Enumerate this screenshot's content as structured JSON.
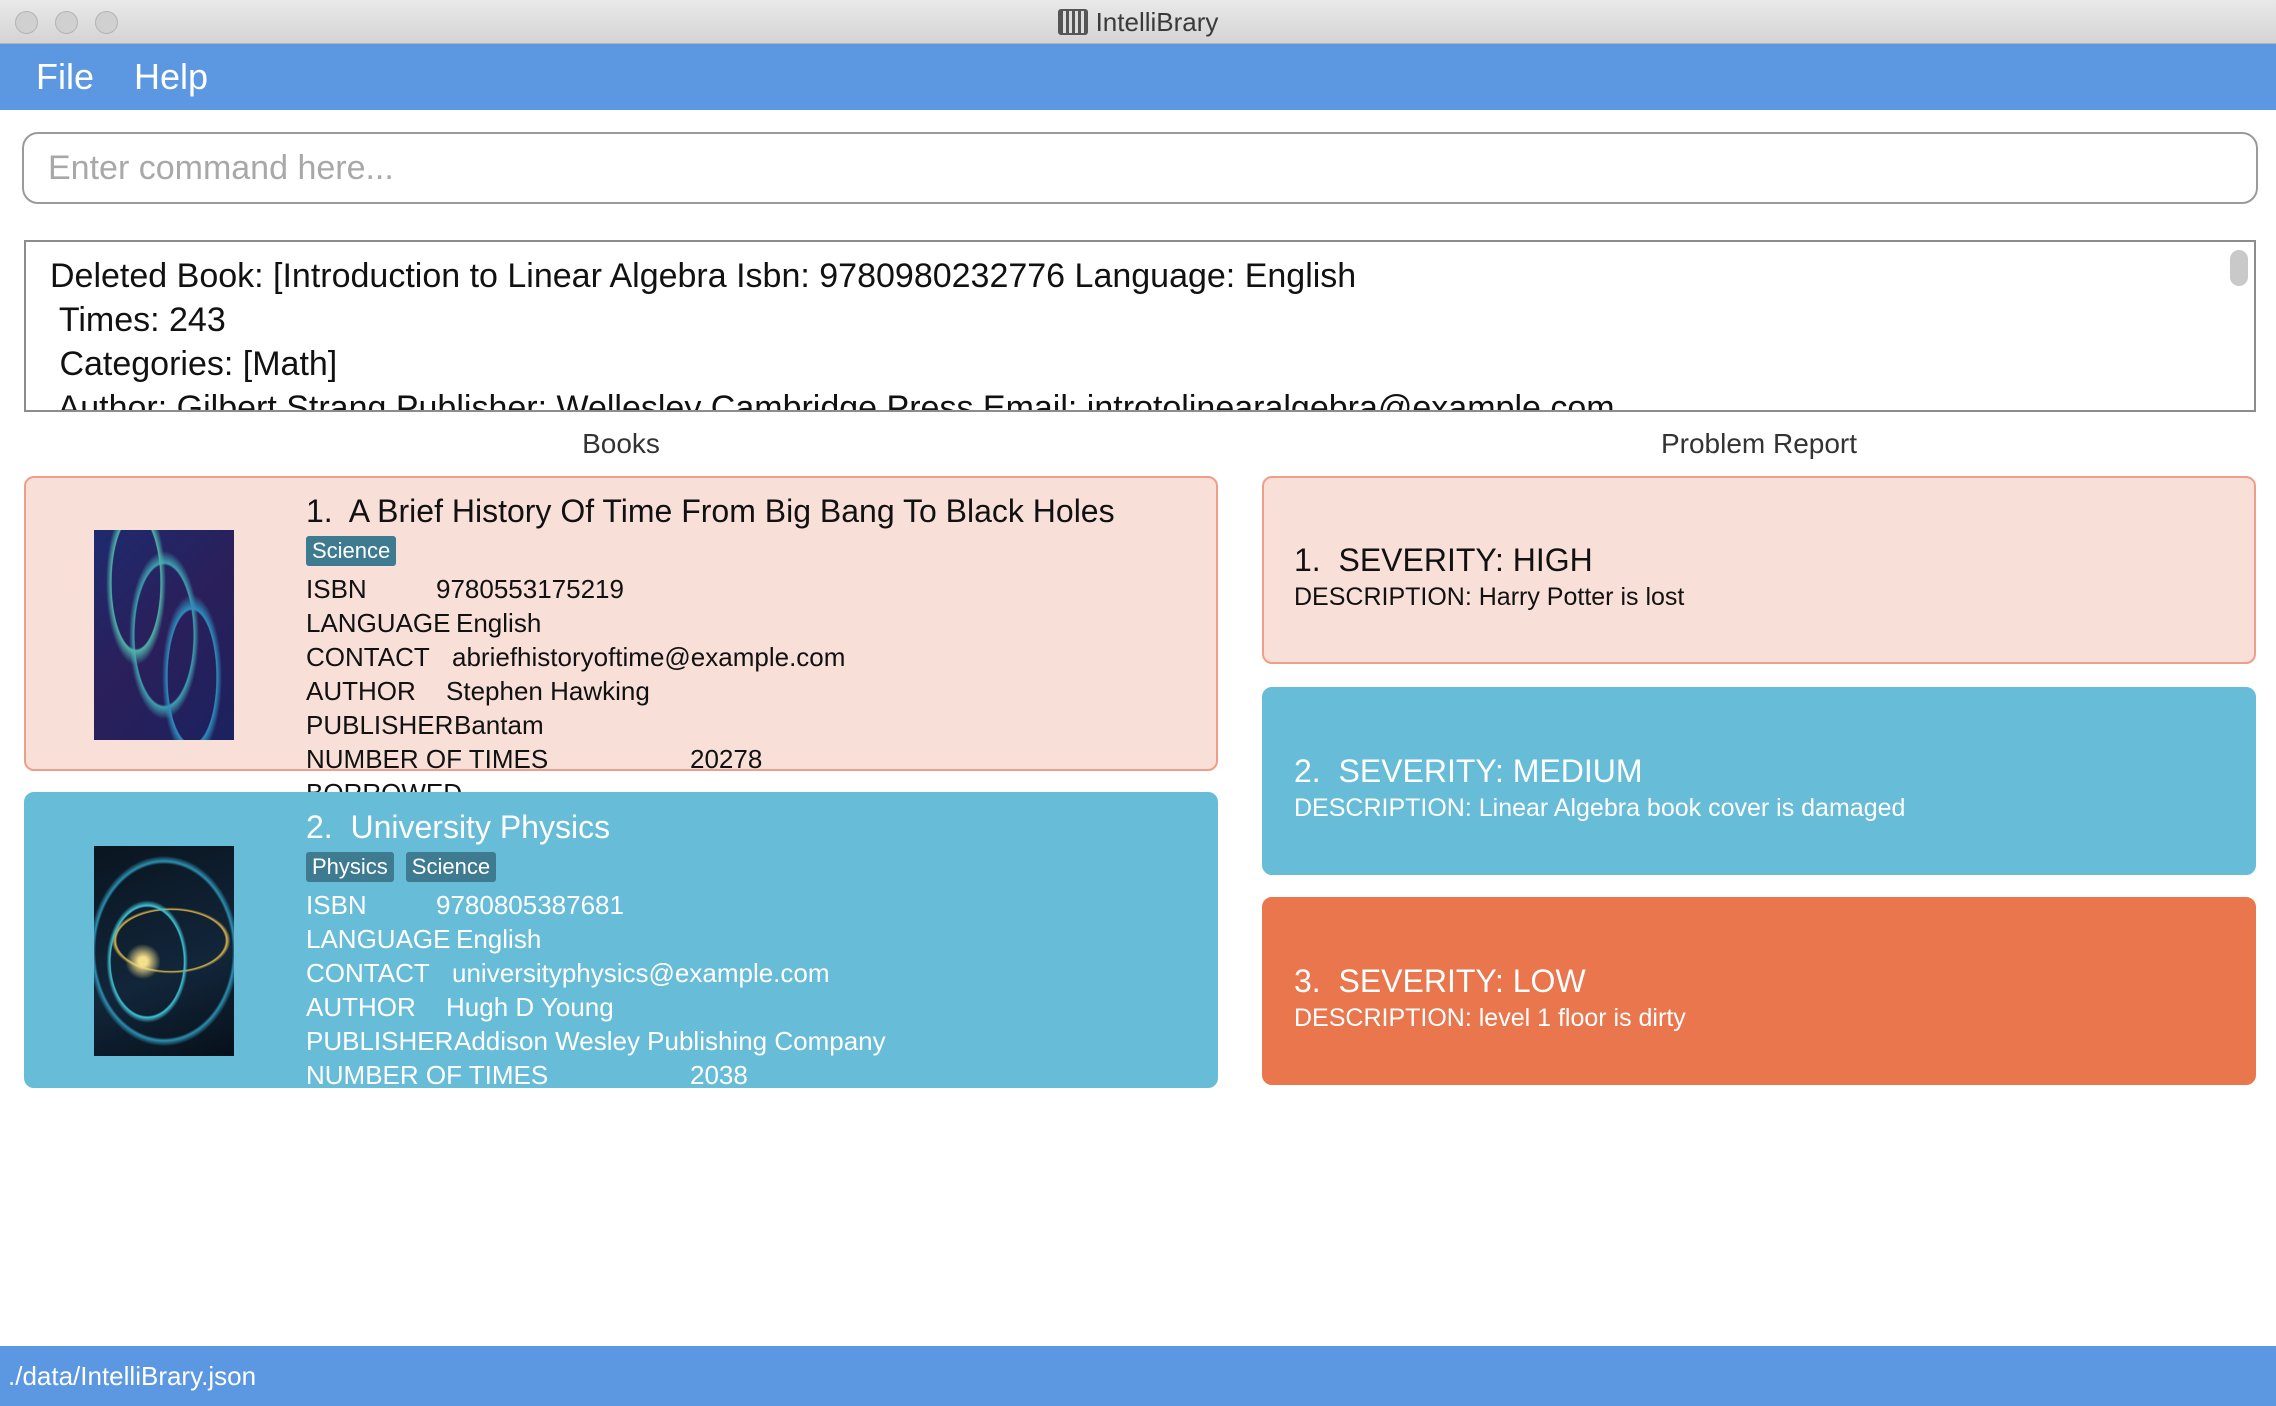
{
  "window": {
    "title": "IntelliBrary"
  },
  "menu": {
    "items": [
      "File",
      "Help"
    ]
  },
  "command": {
    "placeholder": "Enter command here..."
  },
  "result": {
    "lines": [
      "Deleted Book: [Introduction to Linear Algebra Isbn: 9780980232776 Language: English",
      " Times: 243",
      " Categories: [Math]",
      " Author: Gilbert Strang Publisher: Wellesley Cambridge Press Email: introtolinearalgebra@example.com"
    ]
  },
  "books_panel": {
    "title": "Books",
    "labels": {
      "isbn": "ISBN",
      "language": "LANGUAGE",
      "contact": "CONTACT",
      "author": "AUTHOR",
      "publisher": "PUBLISHER",
      "borrowed": "NUMBER OF TIMES BORROWED"
    },
    "books": [
      {
        "index": "1.",
        "title": "A Brief History Of Time From Big Bang To Black Holes",
        "tags": [
          "Science"
        ],
        "isbn": "9780553175219",
        "language": "English",
        "contact": "abriefhistoryoftime@example.com",
        "author": "Stephen Hawking",
        "publisher": "Bantam",
        "borrowed": "20278",
        "cover": "dna-helix-cover"
      },
      {
        "index": "2.",
        "title": "University Physics",
        "tags": [
          "Physics",
          "Science"
        ],
        "isbn": "9780805387681",
        "language": "English",
        "contact": "universityphysics@example.com",
        "author": "Hugh D Young",
        "publisher": "Addison Wesley Publishing Company",
        "borrowed": "2038",
        "cover": "space-vortex-cover"
      }
    ]
  },
  "problems_panel": {
    "title": "Problem Report",
    "problems": [
      {
        "index": "1.",
        "severity": "SEVERITY: HIGH",
        "description": "DESCRIPTION: Harry Potter is lost"
      },
      {
        "index": "2.",
        "severity": "SEVERITY: MEDIUM",
        "description": "DESCRIPTION: Linear Algebra book cover is damaged"
      },
      {
        "index": "3.",
        "severity": "SEVERITY: LOW",
        "description": "DESCRIPTION: level 1 floor is dirty"
      }
    ]
  },
  "status": {
    "path": "./data/IntelliBrary.json"
  },
  "colors": {
    "accent": "#5b98e1",
    "card_pink": "#f8e0d9",
    "card_blue": "#67bcd8",
    "card_orange": "#ea764d",
    "tag": "#3e7b91"
  }
}
